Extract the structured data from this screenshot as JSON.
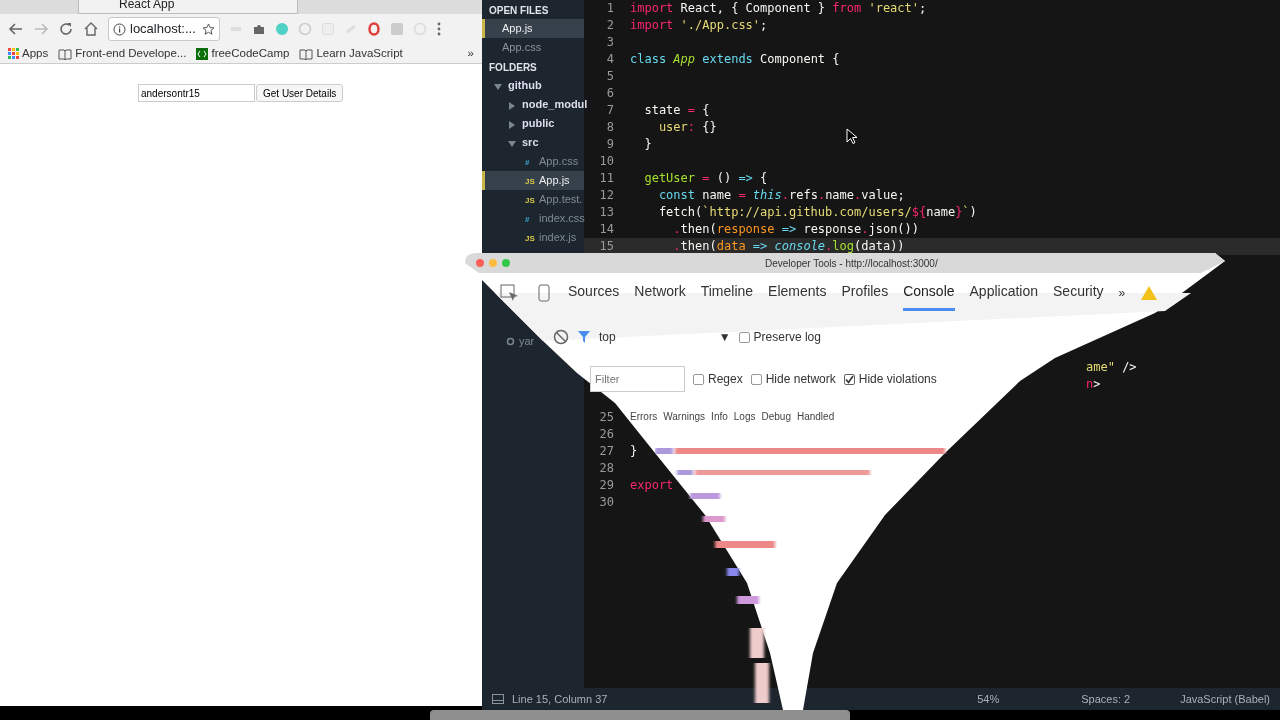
{
  "browser": {
    "tab": {
      "title": "React App",
      "selected": true
    },
    "address": "localhost:...",
    "bookmarks": [
      {
        "label": "Apps",
        "kind": "apps"
      },
      {
        "label": "Front-end Develope...",
        "kind": "book"
      },
      {
        "label": "freeCodeCamp",
        "kind": "fcc"
      },
      {
        "label": "Learn JavaScript",
        "kind": "book"
      }
    ],
    "bookmarks_more": "»",
    "page": {
      "username_value": "andersontr15",
      "button": "Get User Details"
    }
  },
  "editor": {
    "sidebar": {
      "open_files_header": "OPEN FILES",
      "open_files": [
        {
          "name": "App.js",
          "selected": true
        },
        {
          "name": "App.css",
          "selected": false
        }
      ],
      "folders_header": "FOLDERS",
      "tree": [
        {
          "name": "github",
          "kind": "folder",
          "expanded": true,
          "children": [
            {
              "name": "node_modul",
              "kind": "folder",
              "expanded": false
            },
            {
              "name": "public",
              "kind": "folder",
              "expanded": false
            },
            {
              "name": "src",
              "kind": "folder",
              "expanded": true,
              "children": [
                {
                  "name": "App.css",
                  "kind": "css",
                  "icon": "#",
                  "selected": false
                },
                {
                  "name": "App.js",
                  "kind": "js",
                  "icon": "JS",
                  "selected": true
                },
                {
                  "name": "App.test.",
                  "kind": "js",
                  "icon": "JS",
                  "selected": false
                },
                {
                  "name": "index.css",
                  "kind": "css",
                  "icon": "#",
                  "selected": false
                },
                {
                  "name": "index.js",
                  "kind": "js",
                  "icon": "JS",
                  "selected": false
                }
              ]
            }
          ]
        }
      ],
      "partial_item": "yar"
    },
    "code_top": [
      {
        "number": "1",
        "tokens": [
          {
            "text": "import",
            "kind": "keyword"
          },
          {
            "text": " React, { Component } ",
            "kind": "plain"
          },
          {
            "text": "from",
            "kind": "keyword"
          },
          {
            "text": " 'react'",
            "kind": "string"
          },
          {
            "text": ";",
            "kind": "plain"
          }
        ]
      },
      {
        "number": "2",
        "tokens": [
          {
            "text": "import",
            "kind": "keyword"
          },
          {
            "text": " './App.css'",
            "kind": "string"
          },
          {
            "text": ";",
            "kind": "plain"
          }
        ]
      },
      {
        "number": "3"
      },
      {
        "number": "4",
        "tokens": [
          {
            "text": "class",
            "kind": "storage"
          },
          {
            "text": " App",
            "kind": "classname"
          },
          {
            "text": " extends",
            "kind": "storage"
          },
          {
            "text": " Component {",
            "kind": "plain"
          }
        ]
      },
      {
        "number": "5"
      },
      {
        "number": "6"
      },
      {
        "number": "7",
        "tokens": [
          {
            "text": "  state ",
            "kind": "plain"
          },
          {
            "text": "=",
            "kind": "keyword"
          },
          {
            "text": " {",
            "kind": "plain"
          }
        ]
      },
      {
        "number": "8",
        "tokens": [
          {
            "text": "    user",
            "kind": "property"
          },
          {
            "text": ":",
            "kind": "keyword"
          },
          {
            "text": " {}",
            "kind": "plain"
          }
        ]
      },
      {
        "number": "9",
        "tokens": [
          {
            "text": "  }",
            "kind": "plain"
          }
        ]
      },
      {
        "number": "10"
      },
      {
        "number": "11",
        "tokens": [
          {
            "text": "  getUser",
            "kind": "function"
          },
          {
            "text": " =",
            "kind": "keyword"
          },
          {
            "text": " () ",
            "kind": "plain"
          },
          {
            "text": "=>",
            "kind": "storage"
          },
          {
            "text": " {",
            "kind": "plain"
          }
        ]
      },
      {
        "number": "12",
        "tokens": [
          {
            "text": "    const",
            "kind": "storage"
          },
          {
            "text": " name ",
            "kind": "plain"
          },
          {
            "text": "=",
            "kind": "keyword"
          },
          {
            "text": " this",
            "kind": "builtin"
          },
          {
            "text": ".",
            "kind": "keyword"
          },
          {
            "text": "refs",
            "kind": "plain"
          },
          {
            "text": ".",
            "kind": "keyword"
          },
          {
            "text": "name",
            "kind": "plain"
          },
          {
            "text": ".",
            "kind": "keyword"
          },
          {
            "text": "value;",
            "kind": "plain"
          }
        ]
      },
      {
        "number": "13",
        "tokens": [
          {
            "text": "    fetch(",
            "kind": "plain"
          },
          {
            "text": "`http://api.github.com/users/",
            "kind": "string"
          },
          {
            "text": "${",
            "kind": "keyword"
          },
          {
            "text": "name",
            "kind": "plain"
          },
          {
            "text": "}",
            "kind": "keyword"
          },
          {
            "text": "`",
            "kind": "string"
          },
          {
            "text": ")",
            "kind": "plain"
          }
        ]
      },
      {
        "number": "14",
        "tokens": [
          {
            "text": "      .",
            "kind": "keyword"
          },
          {
            "text": "then(",
            "kind": "plain"
          },
          {
            "text": "response",
            "kind": "parameter"
          },
          {
            "text": " =>",
            "kind": "storage"
          },
          {
            "text": " response",
            "kind": "plain"
          },
          {
            "text": ".",
            "kind": "keyword"
          },
          {
            "text": "json())",
            "kind": "plain"
          }
        ]
      },
      {
        "number": "15",
        "current": true,
        "tokens": [
          {
            "text": "      .",
            "kind": "keyword"
          },
          {
            "text": "then(",
            "kind": "plain"
          },
          {
            "text": "data",
            "kind": "parameter"
          },
          {
            "text": " =>",
            "kind": "storage"
          },
          {
            "text": " console",
            "kind": "builtin"
          },
          {
            "text": ".",
            "kind": "keyword"
          },
          {
            "text": "log",
            "kind": "function"
          },
          {
            "text": "(data))",
            "kind": "plain"
          }
        ]
      }
    ],
    "code_fragments": [
      {
        "tokens": [
          {
            "text": "ame\"",
            "kind": "string"
          },
          {
            "text": " />",
            "kind": "plain"
          }
        ]
      },
      {
        "tokens": [
          {
            "text": "n",
            "kind": "keyword"
          },
          {
            "text": ">",
            "kind": "plain"
          }
        ]
      }
    ],
    "code_bottom": [
      {
        "number": "25"
      },
      {
        "number": "26"
      },
      {
        "number": "27",
        "tokens": [
          {
            "text": "}",
            "kind": "plain"
          }
        ]
      },
      {
        "number": "28"
      },
      {
        "number": "29",
        "tokens": [
          {
            "text": "export",
            "kind": "keyword"
          }
        ]
      },
      {
        "number": "30"
      }
    ],
    "status_bar": {
      "position": "Line 15, Column 37",
      "zoom": "54%",
      "indent": "Spaces: 2",
      "syntax": "JavaScript (Babel)"
    }
  },
  "devtools": {
    "title": "Developer Tools - http://localhost:3000/",
    "tabs": [
      {
        "label": "Sources",
        "selected": false
      },
      {
        "label": "Network",
        "selected": false
      },
      {
        "label": "Timeline",
        "selected": false
      },
      {
        "label": "Elements",
        "selected": false
      },
      {
        "label": "Profiles",
        "selected": false
      },
      {
        "label": "Console",
        "selected": true
      },
      {
        "label": "Application",
        "selected": false
      },
      {
        "label": "Security",
        "selected": false
      }
    ],
    "tabs_more": "»",
    "context": "top",
    "context_caret": "▼",
    "preserve_log": {
      "label": "Preserve log",
      "checked": false
    },
    "filter_placeholder": "Filter",
    "filter_options": [
      {
        "label": "Regex",
        "checked": false
      },
      {
        "label": "Hide network",
        "checked": false
      },
      {
        "label": "Hide violations",
        "checked": true
      }
    ],
    "levels": [
      "Errors",
      "Warnings",
      "Info",
      "Logs",
      "Debug",
      "Handled"
    ]
  }
}
